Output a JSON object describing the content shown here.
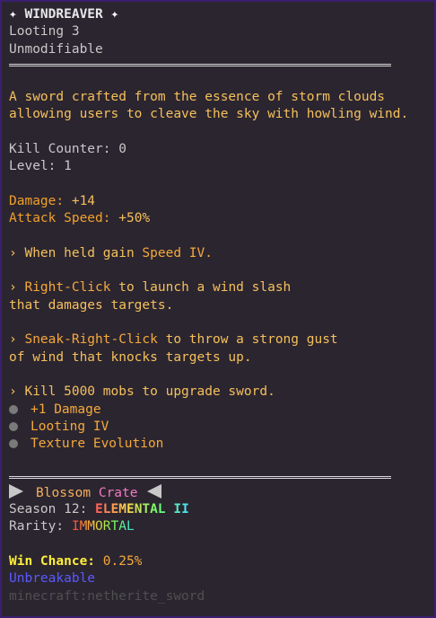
{
  "item": {
    "star_glyph": "✦",
    "name": "WINDREAVER",
    "enchant": "Looting 3",
    "modifiable": "Unmodifiable"
  },
  "description": [
    "A sword crafted from the essence of storm clouds",
    "allowing users to cleave the sky with howling wind."
  ],
  "stats": {
    "kill_label": "Kill Counter:",
    "kill_value": "0",
    "level_label": "Level:",
    "level_value": "1",
    "damage_label": "Damage:",
    "damage_value": "+14",
    "speed_label": "Attack Speed:",
    "speed_value": "+50%"
  },
  "abilities": {
    "bullet": "›",
    "held_prefix": "When held gain ",
    "held_effect": "Speed IV.",
    "right_key": "Right-Click",
    "right_rest": " to launch a wind slash",
    "right_line2": "that damages targets.",
    "sneak_key": "Sneak-Right-Click",
    "sneak_rest": " to throw a strong gust",
    "sneak_line2": "of wind that knocks targets up."
  },
  "upgrade": {
    "header": "› Kill 5000 mobs to upgrade sword.",
    "items": [
      "+1 Damage",
      "Looting IV",
      "Texture Evolution"
    ]
  },
  "crate": {
    "name_a": "Blossom",
    "name_b": "Crate",
    "season_label": "Season 12:",
    "season_value": "ELEMENTAL II",
    "rarity_label": "Rarity:",
    "rarity_value": "IMMORTAL"
  },
  "footer": {
    "win_label": "Win Chance:",
    "win_value": "0.25%",
    "unbreakable": "Unbreakable",
    "item_id": "minecraft:netherite_sword"
  },
  "colors": {
    "background": "#2b2530",
    "border": "#3a1f6e",
    "gold": "#f5a93a",
    "blue": "#5a5aff"
  }
}
